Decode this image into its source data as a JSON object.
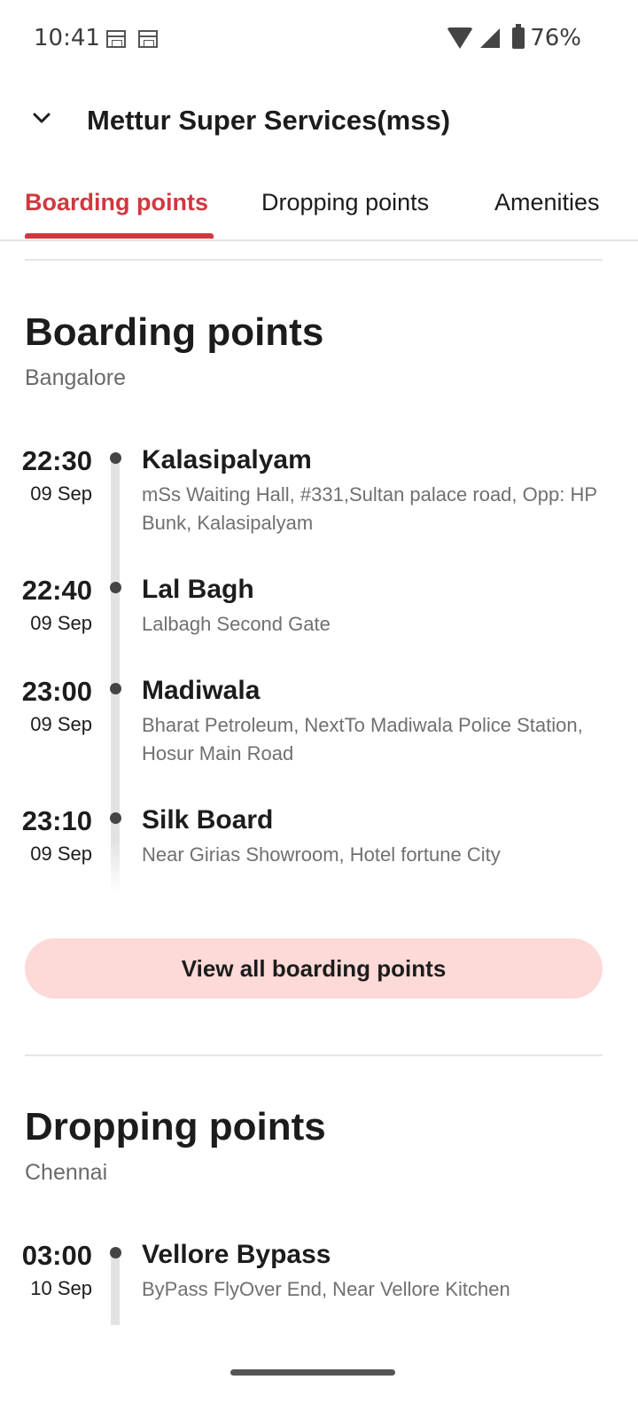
{
  "status_bar": {
    "time": "10:41",
    "battery": "76%"
  },
  "header": {
    "title": "Mettur Super Services(mss)"
  },
  "tabs": [
    {
      "label": "Boarding points"
    },
    {
      "label": "Dropping points"
    },
    {
      "label": "Amenities"
    }
  ],
  "boarding": {
    "title": "Boarding points",
    "city": "Bangalore",
    "stops": [
      {
        "time": "22:30",
        "date": "09 Sep",
        "name": "Kalasipalyam",
        "address": "mSs Waiting Hall, #331,Sultan palace road, Opp: HP Bunk, Kalasipalyam"
      },
      {
        "time": "22:40",
        "date": "09 Sep",
        "name": "Lal Bagh",
        "address": "Lalbagh Second Gate"
      },
      {
        "time": "23:00",
        "date": "09 Sep",
        "name": "Madiwala",
        "address": "Bharat Petroleum, NextTo Madiwala Police Station, Hosur Main Road"
      },
      {
        "time": "23:10",
        "date": "09 Sep",
        "name": "Silk Board",
        "address": "Near Girias Showroom,  Hotel fortune City"
      }
    ],
    "view_all_label": "View all boarding points"
  },
  "dropping": {
    "title": "Dropping points",
    "city": "Chennai",
    "stops": [
      {
        "time": "03:00",
        "date": "10 Sep",
        "name": "Vellore Bypass",
        "address": "ByPass FlyOver End, Near Vellore Kitchen"
      }
    ]
  },
  "colors": {
    "accent": "#d0383f",
    "button_bg": "#fdd9d7"
  }
}
